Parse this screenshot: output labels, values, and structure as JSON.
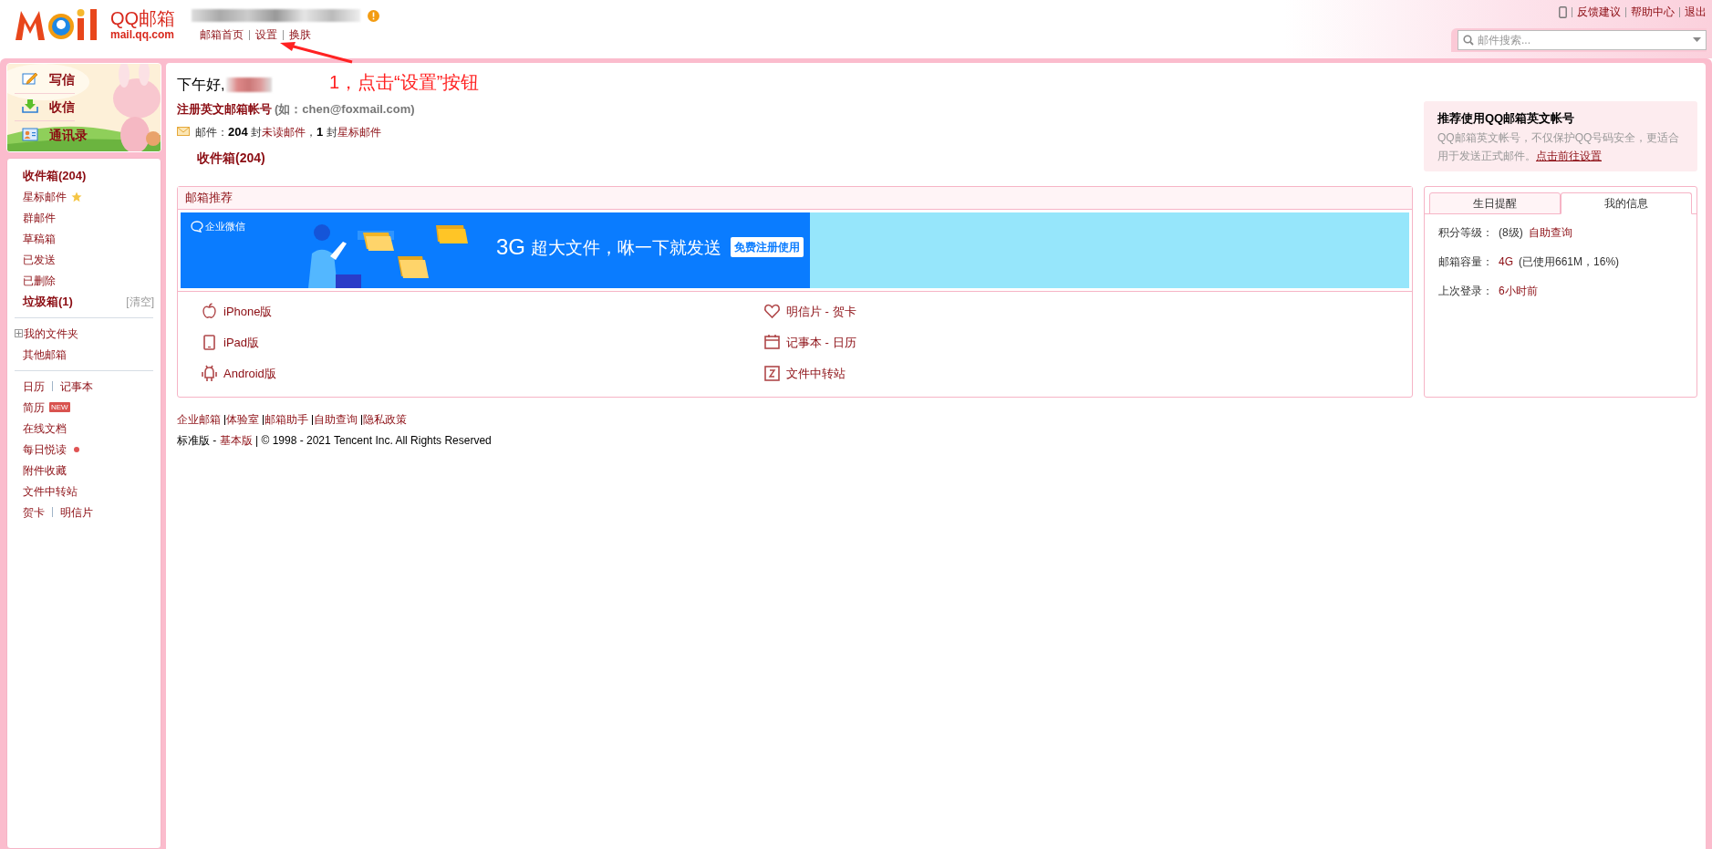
{
  "header": {
    "logo": {
      "brand": "QQ邮箱",
      "domain": "mail.qq.com"
    },
    "nav_links": [
      "邮箱首页",
      "设置",
      "换肤"
    ],
    "top_links": [
      "反馈建议",
      "帮助中心",
      "退出"
    ],
    "search": {
      "placeholder": "邮件搜索..."
    }
  },
  "annotation": {
    "text": "1，点击“设置”按钮"
  },
  "sidebar": {
    "actions": [
      {
        "label": "写信",
        "kind": "compose"
      },
      {
        "label": "收信",
        "kind": "receive"
      },
      {
        "label": "通讯录",
        "kind": "contacts"
      }
    ],
    "groups": [
      [
        {
          "kind": "plain",
          "labels": [
            "收件箱(204)"
          ],
          "bold": true
        },
        {
          "kind": "star",
          "labels": [
            "星标邮件"
          ],
          "bold": false
        },
        {
          "kind": "plain",
          "labels": [
            "群邮件"
          ],
          "bold": false
        },
        {
          "kind": "plain",
          "labels": [
            "草稿箱"
          ],
          "bold": false
        },
        {
          "kind": "plain",
          "labels": [
            "已发送"
          ],
          "bold": false
        },
        {
          "kind": "plain",
          "labels": [
            "已删除"
          ],
          "bold": false
        },
        {
          "kind": "clear",
          "labels": [
            "垃圾箱(1)"
          ],
          "bold": true,
          "action": "[清空]"
        }
      ],
      [
        {
          "kind": "expandable",
          "labels": [
            "我的文件夹"
          ],
          "bold": false
        },
        {
          "kind": "plain",
          "labels": [
            "其他邮箱"
          ],
          "bold": false
        }
      ],
      [
        {
          "kind": "plain",
          "labels": [
            "日历",
            "记事本"
          ],
          "bold": false
        },
        {
          "kind": "badge",
          "labels": [
            "简历"
          ],
          "bold": false,
          "badge": "NEW"
        },
        {
          "kind": "plain",
          "labels": [
            "在线文档"
          ],
          "bold": false
        },
        {
          "kind": "dot",
          "labels": [
            "每日悦读"
          ],
          "bold": false
        },
        {
          "kind": "plain",
          "labels": [
            "附件收藏"
          ],
          "bold": false
        },
        {
          "kind": "plain",
          "labels": [
            "文件中转站"
          ],
          "bold": false
        },
        {
          "kind": "plain",
          "labels": [
            "贺卡",
            "明信片"
          ],
          "bold": false
        }
      ]
    ]
  },
  "main": {
    "greeting": "下午好,",
    "register_link": "注册英文邮箱帐号",
    "register_hint": "(如：chen@foxmail.com)",
    "summary": [
      {
        "kind": "plain",
        "text": "邮件："
      },
      {
        "kind": "bold",
        "text": "204"
      },
      {
        "kind": "plain",
        "text": " 封"
      },
      {
        "kind": "link",
        "text": "未读邮件"
      },
      {
        "kind": "plain",
        "text": "，"
      },
      {
        "kind": "bold",
        "text": "1"
      },
      {
        "kind": "plain",
        "text": " 封"
      },
      {
        "kind": "link",
        "text": "星标邮件"
      }
    ],
    "inbox_link": "收件箱(204)"
  },
  "recommend": {
    "title": "邮箱推荐",
    "banner": {
      "brand": "企业微信",
      "size": "3G",
      "headline": "超大文件，咻一下就发送",
      "button": "免费注册使用"
    },
    "apps": [
      {
        "kind": "apple",
        "label": "iPhone版"
      },
      {
        "kind": "heart",
        "label": "明信片 - 贺卡"
      },
      {
        "kind": "tablet",
        "label": "iPad版"
      },
      {
        "kind": "calendar",
        "label": "记事本 - 日历"
      },
      {
        "kind": "android",
        "label": "Android版"
      },
      {
        "kind": "transfer",
        "label": "文件中转站"
      }
    ]
  },
  "promo": {
    "title": "推荐使用QQ邮箱英文帐号",
    "body": "QQ邮箱英文帐号，不仅保护QQ号码安全，更适合用于发送正式邮件。",
    "link": "点击前往设置"
  },
  "info": {
    "tabs": [
      {
        "label": "生日提醒",
        "selected": false
      },
      {
        "label": "我的信息",
        "selected": true
      }
    ],
    "rows": [
      {
        "label": "积分等级：",
        "segments": [
          {
            "kind": "plain",
            "text": "(8级)"
          },
          {
            "kind": "link",
            "text": "自助查询"
          }
        ]
      },
      {
        "label": "邮箱容量：",
        "segments": [
          {
            "kind": "link",
            "text": "4G"
          },
          {
            "kind": "plain",
            "text": "(已使用661M，16%)"
          }
        ]
      },
      {
        "label": "上次登录：",
        "segments": [
          {
            "kind": "link",
            "text": "6小时前"
          }
        ]
      }
    ]
  },
  "footer": {
    "links": [
      "企业邮箱",
      "体验室",
      "邮箱助手",
      "自助查询",
      "隐私政策"
    ],
    "edition": "标准版 - ",
    "edition_link": "基本版",
    "copyright": " | © 1998 - 2021 Tencent Inc. All Rights Reserved"
  }
}
